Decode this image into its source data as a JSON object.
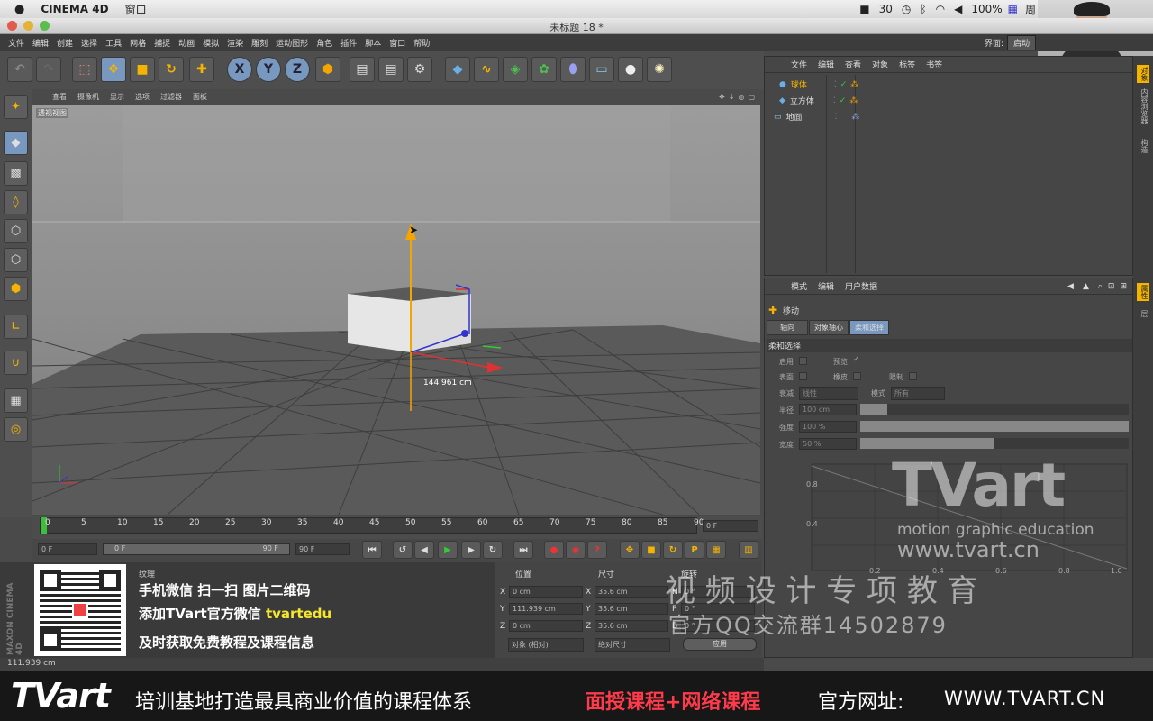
{
  "mac_menubar": {
    "app": "CINEMA 4D",
    "menu": "窗口",
    "status": {
      "battery": "100%",
      "day": "周",
      "ai": "30"
    }
  },
  "window": {
    "title": "未标题 18 *"
  },
  "app_menu": [
    "文件",
    "编辑",
    "创建",
    "选择",
    "工具",
    "网格",
    "捕捉",
    "动画",
    "模拟",
    "渲染",
    "雕刻",
    "运动图形",
    "角色",
    "插件",
    "脚本",
    "窗口",
    "帮助"
  ],
  "layout": {
    "label": "界面:",
    "value": "启动"
  },
  "toolbar": {
    "x": "X",
    "y": "Y",
    "z": "Z"
  },
  "viewport": {
    "menu": [
      "查看",
      "摄像机",
      "显示",
      "选项",
      "过滤器",
      "面板"
    ],
    "name": "透视视图",
    "measure": "144.961 cm",
    "subtitle": "最具商业价值的课程体系"
  },
  "timeline": {
    "ticks": [
      "0",
      "5",
      "10",
      "15",
      "20",
      "25",
      "30",
      "35",
      "40",
      "45",
      "50",
      "55",
      "60",
      "65",
      "70",
      "75",
      "80",
      "85",
      "90"
    ],
    "current": "0 F"
  },
  "transport": {
    "start": "0 F",
    "range_start": "0 F",
    "range_end": "90 F",
    "end": "90 F"
  },
  "texture_label": "纹理",
  "promo": {
    "line1": "手机微信  扫一扫  图片二维码",
    "line2_pre": "添加TVart官方微信 ",
    "line2_id": "tvartedu",
    "line3": "及时获取免费教程及课程信息",
    "maxon": "MAXON CINEMA 4D"
  },
  "coords": {
    "headers": [
      "位置",
      "尺寸",
      "旋转"
    ],
    "rows": [
      {
        "axis": "X",
        "pos": "0 cm",
        "saxis": "X",
        "size": "35.6 cm",
        "raxis": "H",
        "rot": "0 °"
      },
      {
        "axis": "Y",
        "pos": "111.939 cm",
        "saxis": "Y",
        "size": "35.6 cm",
        "raxis": "P",
        "rot": "0 °"
      },
      {
        "axis": "Z",
        "pos": "0 cm",
        "saxis": "Z",
        "size": "35.6 cm",
        "raxis": "B",
        "rot": "0 °"
      }
    ],
    "mode1": "对象 (相对)",
    "mode2": "绝对尺寸",
    "apply": "应用"
  },
  "status_value": "111.939 cm",
  "objects": {
    "menu": [
      "文件",
      "编辑",
      "查看",
      "对象",
      "标签",
      "书签"
    ],
    "items": [
      {
        "name": "球体"
      },
      {
        "name": "立方体"
      },
      {
        "name": "地面"
      }
    ]
  },
  "attributes": {
    "menu": [
      "模式",
      "编辑",
      "用户数据"
    ],
    "tool": "移动",
    "tabs": [
      "轴向",
      "对象轴心",
      "柔和选择"
    ],
    "section": "柔和选择",
    "enable": "启用",
    "preview": "预览",
    "surface": "表面",
    "rubber": "橡皮",
    "restrict": "限制",
    "falloff_label": "衰减",
    "falloff": "线性",
    "mode_label": "模式",
    "mode": "所有",
    "radius_label": "半径",
    "radius": "100 cm",
    "strength_label": "强度",
    "strength": "100 %",
    "width_label": "宽度",
    "width": "50 %",
    "graph_y": [
      "0.8",
      "0.4"
    ],
    "graph_x": [
      "0.2",
      "0.4",
      "0.6",
      "0.8",
      "1.0"
    ]
  },
  "right_tabs": [
    "对象",
    "内容浏览器",
    "构造",
    "属性",
    "层"
  ],
  "watermark": {
    "brand": "TVart",
    "tagline": "motion graphic education",
    "url": "www.tvart.cn",
    "cn1": "视 频 设 计 专 项 教 育",
    "cn2": "官方QQ交流群14502879"
  },
  "banner": {
    "logo": "TVart",
    "slogan": "培训基地打造最具商业价值的课程体系",
    "courses": "面授课程+网络课程",
    "site_label": "官方网址:",
    "site": "WWW.TVART.CN"
  }
}
